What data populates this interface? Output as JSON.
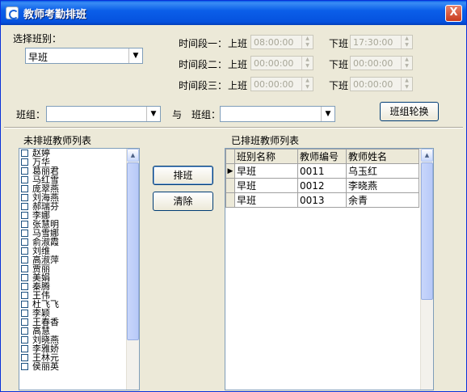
{
  "window": {
    "title": "教师考勤排班",
    "close_glyph": "X"
  },
  "class_select": {
    "label": "选择班别：",
    "value": "早班"
  },
  "time_slots": [
    {
      "label": "时间段一：",
      "on_label": "上班",
      "on_value": "08:00:00",
      "off_label": "下班",
      "off_value": "17:30:00"
    },
    {
      "label": "时间段二：",
      "on_label": "上班",
      "on_value": "00:00:00",
      "off_label": "下班",
      "off_value": "00:00:00"
    },
    {
      "label": "时间段三：",
      "on_label": "上班",
      "on_value": "00:00:00",
      "off_label": "下班",
      "off_value": "00:00:00"
    }
  ],
  "group": {
    "label1": "班组：",
    "value1": "",
    "with": "与",
    "label2": "班组：",
    "value2": "",
    "swap_button": "班组轮换"
  },
  "unscheduled": {
    "title": "未排班教师列表",
    "teachers": [
      "赵婷",
      "万华",
      "葛丽君",
      "马红雪",
      "庞翠燕",
      "刘海燕",
      "郝瑞芬",
      "李娜",
      "张慧明",
      "马雪娜",
      "俞淑霞",
      "刘维",
      "高淑萍",
      "贾丽",
      "美娟",
      "秦腾",
      "王伟",
      "杜飞飞",
      "李颖",
      "王春香",
      "高慧",
      "刘晓燕",
      "李雅娇",
      "王林元",
      "侯丽英"
    ]
  },
  "actions": {
    "schedule": "排班",
    "clear": "清除"
  },
  "scheduled": {
    "title": "已排班教师列表",
    "columns": [
      "班别名称",
      "教师编号",
      "教师姓名"
    ],
    "rows": [
      [
        "早班",
        "0011",
        "乌玉红"
      ],
      [
        "早班",
        "0012",
        "李晓燕"
      ],
      [
        "早班",
        "0013",
        "余青"
      ]
    ]
  }
}
